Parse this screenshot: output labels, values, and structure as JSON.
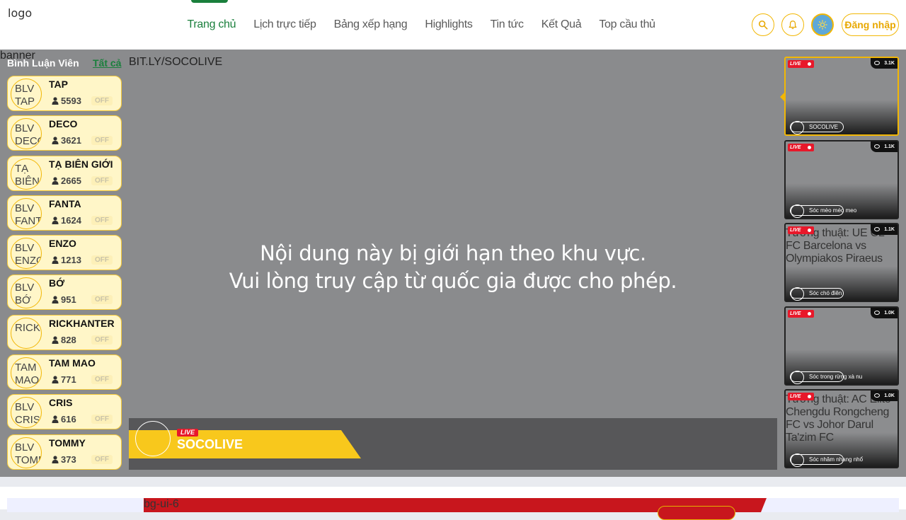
{
  "header": {
    "logo_alt": "logo",
    "nav": [
      {
        "label": "Trang chủ",
        "active": true
      },
      {
        "label": "Lịch trực tiếp"
      },
      {
        "label": "Bảng xếp hạng"
      },
      {
        "label": "Highlights"
      },
      {
        "label": "Tin tức"
      },
      {
        "label": "Kết Quả"
      },
      {
        "label": "Top cầu thủ"
      }
    ],
    "login_label": "Đăng nhập",
    "accent": "#f2b705",
    "active_color": "#1a7f3c"
  },
  "stage": {
    "banner_alt": "banner",
    "commentators_title": "Bình Luận Viên",
    "see_all": "Tất cả",
    "commentators": [
      {
        "avatar_alt": "BLV TAP",
        "name": "TAP",
        "viewers": "5593",
        "status": "OFF"
      },
      {
        "avatar_alt": "BLV DECO",
        "name": "DECO",
        "viewers": "3621",
        "status": "OFF"
      },
      {
        "avatar_alt": "TẠ BIÊN GIỚI",
        "name": "TẠ BIÊN GIỚI",
        "viewers": "2665",
        "status": "OFF"
      },
      {
        "avatar_alt": "BLV FANTA",
        "name": "FANTA",
        "viewers": "1624",
        "status": "OFF"
      },
      {
        "avatar_alt": "BLV ENZO",
        "name": "ENZO",
        "viewers": "1213",
        "status": "OFF"
      },
      {
        "avatar_alt": "BLV BỚ",
        "name": "BỚ",
        "viewers": "951",
        "status": "OFF"
      },
      {
        "avatar_alt": "RICKHANTER",
        "name": "RICKHANTER",
        "viewers": "828",
        "status": "OFF"
      },
      {
        "avatar_alt": "TAM MAO",
        "name": "TAM MAO",
        "viewers": "771",
        "status": "OFF"
      },
      {
        "avatar_alt": "BLV CRIS",
        "name": "CRIS",
        "viewers": "616",
        "status": "OFF"
      },
      {
        "avatar_alt": "BLV TOMMY",
        "name": "TOMMY",
        "viewers": "373",
        "status": "OFF"
      }
    ],
    "player": {
      "image_alt": "BIT.LY/SOCOLIVE",
      "message_line1": "Nội dung này bị giới hạn theo khu vực.",
      "message_line2": "Vui lòng truy cập từ quốc gia được cho phép.",
      "live_label": "LIVE",
      "channel_name": "SOCOLIVE"
    },
    "streams": [
      {
        "live": "LIVE",
        "views": "3.1K",
        "title": "",
        "owner": "SOCOLIVE",
        "active": true
      },
      {
        "live": "LIVE",
        "views": "1.1K",
        "title": "",
        "owner": "Sóc mèo méo meo"
      },
      {
        "live": "LIVE",
        "views": "1.1K",
        "title": "Tường thuật: UE CL FC Barcelona vs Olympiakos Piraeus",
        "owner": "Sóc chó điên"
      },
      {
        "live": "LIVE",
        "views": "1.0K",
        "title": "",
        "owner": "Sóc trong rừng xà nu"
      },
      {
        "live": "LIVE",
        "views": "1.0K",
        "title": "Tường thuật: AC Elite Chengdu Rongcheng FC vs Johor Darul Ta'zim FC",
        "owner": "Sóc nhâm nhang nhổ"
      }
    ]
  },
  "bottom": {
    "banner_alt": "bg-ui-6"
  }
}
